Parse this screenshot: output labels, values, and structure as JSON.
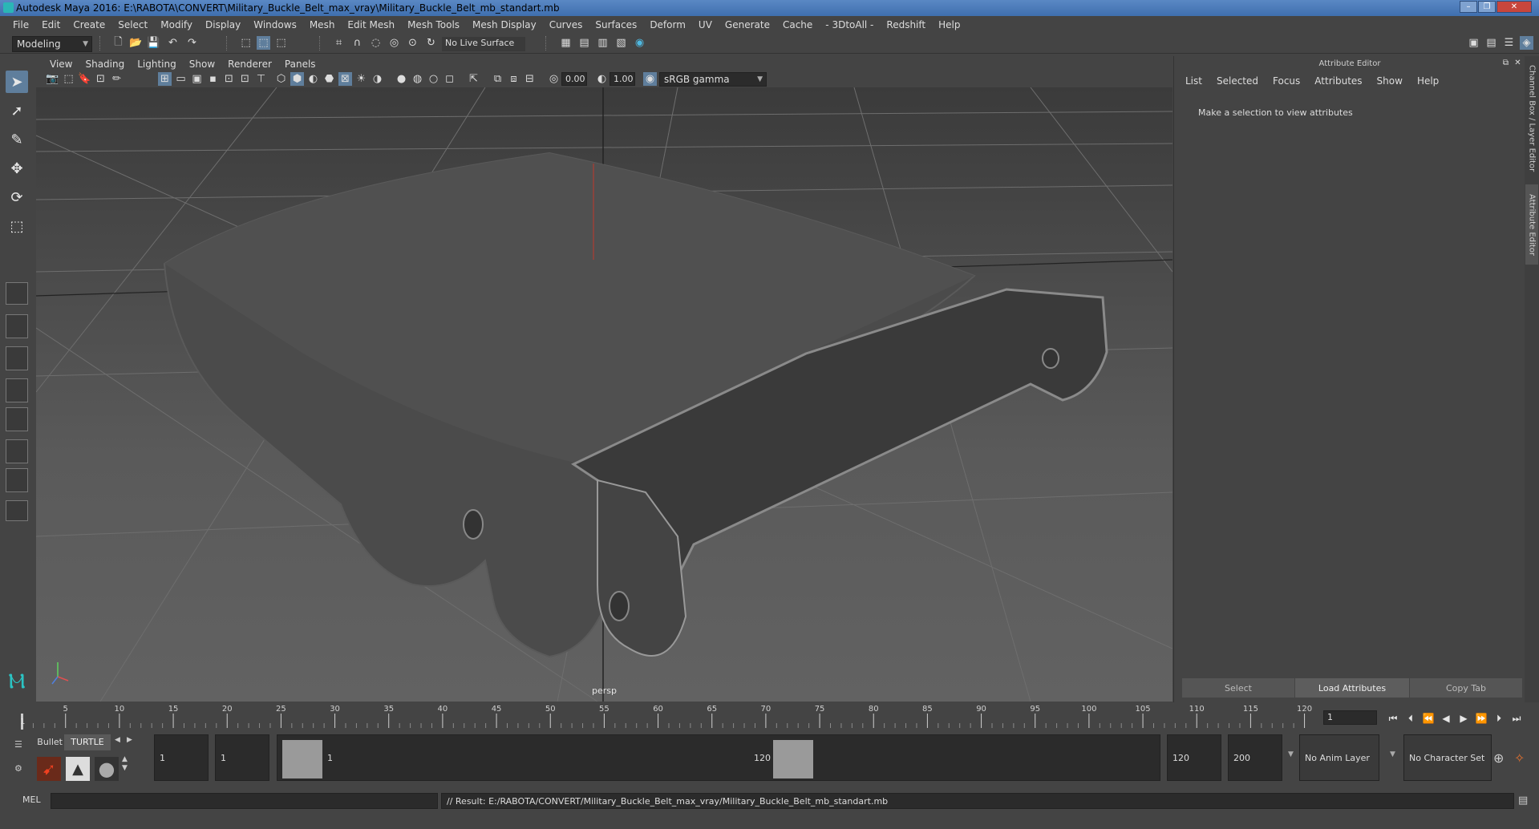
{
  "window": {
    "title": "Autodesk Maya 2016: E:\\RABOTA\\CONVERT\\Military_Buckle_Belt_max_vray\\Military_Buckle_Belt_mb_standart.mb"
  },
  "menubar": [
    "File",
    "Edit",
    "Create",
    "Select",
    "Modify",
    "Display",
    "Windows",
    "Mesh",
    "Edit Mesh",
    "Mesh Tools",
    "Mesh Display",
    "Curves",
    "Surfaces",
    "Deform",
    "UV",
    "Generate",
    "Cache",
    "- 3DtoAll -",
    "Redshift",
    "Help"
  ],
  "statusline": {
    "mode": "Modeling",
    "live_surface": "No Live Surface"
  },
  "viewport": {
    "menu": [
      "View",
      "Shading",
      "Lighting",
      "Show",
      "Renderer",
      "Panels"
    ],
    "exposure": "0.00",
    "gamma": "1.00",
    "color_space": "sRGB gamma",
    "camera_label": "persp"
  },
  "attribute_editor": {
    "title": "Attribute Editor",
    "menu": [
      "List",
      "Selected",
      "Focus",
      "Attributes",
      "Show",
      "Help"
    ],
    "message": "Make a selection to view attributes",
    "buttons": {
      "select": "Select",
      "load": "Load Attributes",
      "copy": "Copy Tab"
    },
    "side_tabs": [
      "Channel Box / Layer Editor",
      "Attribute Editor"
    ]
  },
  "timeline": {
    "ticks": [
      "5",
      "10",
      "15",
      "20",
      "25",
      "30",
      "35",
      "40",
      "45",
      "50",
      "55",
      "60",
      "65",
      "70",
      "75",
      "80",
      "85",
      "90",
      "95",
      "100",
      "105",
      "110",
      "115",
      "120"
    ],
    "start_marker": "1",
    "current_frame": "1"
  },
  "range": {
    "shelf_tabs": [
      "Bullet",
      "TURTLE"
    ],
    "start_time": "1",
    "playback_start": "1",
    "range_start_label": "1",
    "range_end_label": "120",
    "playback_end": "120",
    "end_time": "200",
    "anim_layer": "No Anim Layer",
    "character_set": "No Character Set"
  },
  "cmdline": {
    "lang": "MEL",
    "result": "// Result: E:/RABOTA/CONVERT/Military_Buckle_Belt_max_vray/Military_Buckle_Belt_mb_standart.mb"
  },
  "colors": {
    "accent": "#5f7e9c",
    "titlebar": "#4a7bbb"
  }
}
